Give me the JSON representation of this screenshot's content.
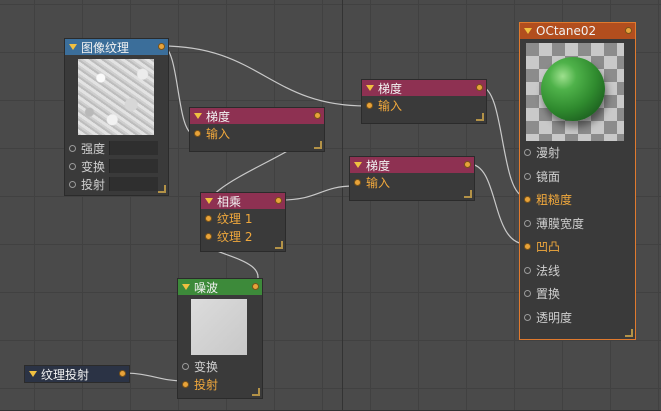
{
  "nodes": {
    "image_texture": {
      "title": "图像纹理",
      "inputs": [
        "强度",
        "变换",
        "投射"
      ]
    },
    "gradient_1": {
      "title": "梯度",
      "input": "输入"
    },
    "gradient_2": {
      "title": "梯度",
      "input": "输入"
    },
    "gradient_3": {
      "title": "梯度",
      "input": "输入"
    },
    "multiply": {
      "title": "相乘",
      "inputs": [
        "纹理 1",
        "纹理 2"
      ]
    },
    "noise": {
      "title": "噪波",
      "inputs": [
        "变换",
        "投射"
      ]
    },
    "projection": {
      "title": "纹理投射"
    },
    "material": {
      "title": "OCtane02",
      "inputs": [
        "漫射",
        "镜面",
        "粗糙度",
        "薄膜宽度",
        "凹凸",
        "法线",
        "置换",
        "透明度"
      ],
      "connected_inputs": [
        "粗糙度",
        "凹凸"
      ]
    }
  },
  "colors": {
    "canvas_bg": "#4a4a4a",
    "wire": "#c9c9c9",
    "port_active": "#e8a33a",
    "header_image_texture": "#3b6e9a",
    "header_gradient": "#8e3152",
    "header_noise": "#3d8a3a",
    "header_projection": "#2b3345",
    "header_material": "#b24e1e",
    "preview_sphere": "#2f8a2e"
  },
  "icons": {
    "collapse": "triangle-down-icon",
    "resize": "resize-grip-icon"
  }
}
